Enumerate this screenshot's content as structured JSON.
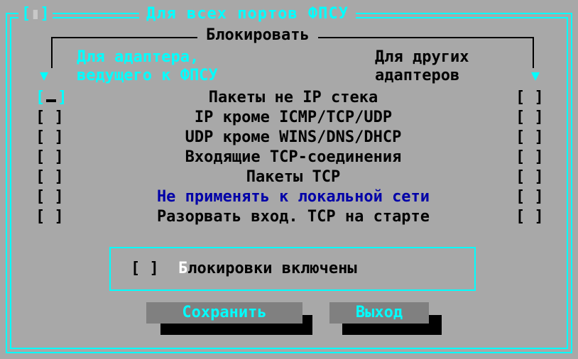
{
  "title": "Для всех портов ФПСУ",
  "close_mark": "▮",
  "group_label": "Блокировать",
  "left_col_title_1": "Для адаптера,",
  "left_col_title_2": "ведущего к ФПСУ",
  "right_col_title_1": "Для других",
  "right_col_title_2": "адаптеров",
  "arrow_glyph": "▼",
  "rows": [
    {
      "left": "[",
      "label": "Пакеты не IP стека",
      "right": "[ ]"
    },
    {
      "left": "[ ]",
      "label": "IP кроме ICMP/TCP/UDP",
      "right": "[ ]"
    },
    {
      "left": "[ ]",
      "label": "UDP кроме WINS/DNS/DHCP",
      "right": "[ ]"
    },
    {
      "left": "[ ]",
      "label": "Входящие TCP-соединения",
      "right": "[ ]"
    },
    {
      "left": "[ ]",
      "label": "Пакеты TCP",
      "right": "[ ]"
    },
    {
      "left": "[ ]",
      "label": "Не применять к локальной сети",
      "right": "[ ]"
    },
    {
      "left": "[ ]",
      "label": "Разорвать вход. TCP на старте",
      "right": "[ ]"
    }
  ],
  "enable": {
    "checkbox": "[ ]",
    "hotkey": "Б",
    "label_rest": "локировки включены"
  },
  "buttons": {
    "save": "Сохранить",
    "exit": "Выход"
  },
  "colors": {
    "background": "#a8a8a8",
    "accent": "#00ffff",
    "blue": "#0000a8"
  }
}
